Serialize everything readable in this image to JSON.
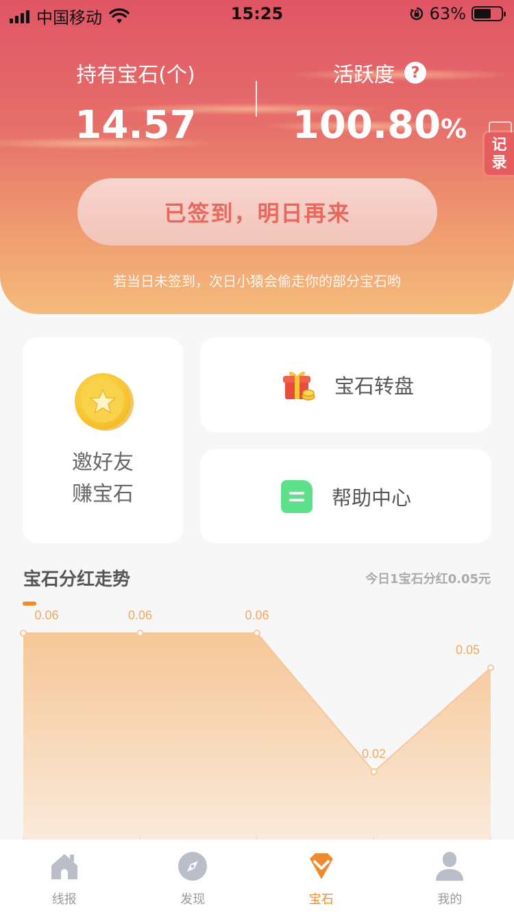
{
  "status_bar": {
    "carrier": "中国移动",
    "time": "15:25",
    "battery": "63%"
  },
  "stats": {
    "gems_label": "持有宝石(个)",
    "gems_value": "14.57",
    "activity_label": "活跃度",
    "activity_value": "100.80",
    "activity_unit": "%"
  },
  "record_tab": {
    "line1": "记",
    "line2": "录"
  },
  "checkin": {
    "button_label": "已签到，明日再来",
    "hint": "若当日未签到，次日小猿会偷走你的部分宝石哟"
  },
  "cards": {
    "invite_line1": "邀好友",
    "invite_line2": "赚宝石",
    "wheel_label": "宝石转盘",
    "help_label": "帮助中心"
  },
  "trend": {
    "title": "宝石分红走势",
    "note": "今日1宝石分红0.05元"
  },
  "chart_data": {
    "type": "area",
    "title": "宝石分红走势",
    "x": [
      "",
      "",
      "",
      "",
      ""
    ],
    "series": [
      {
        "values": [
          0.06,
          0.06,
          0.06,
          0.02,
          0.05
        ]
      }
    ],
    "data_labels": [
      "0.06",
      "0.06",
      "0.06",
      "0.02",
      "0.05"
    ],
    "ylim": [
      0.0,
      0.06
    ],
    "grid": false,
    "colors": {
      "line": "#f5c79c",
      "fill_top": "#f6c797",
      "fill_bottom": "#faeadb",
      "label": "#f0a860",
      "legend": "#ef8a2e"
    }
  },
  "tabbar": {
    "items": [
      {
        "label": "线报",
        "icon": "home-icon"
      },
      {
        "label": "发现",
        "icon": "compass-icon"
      },
      {
        "label": "宝石",
        "icon": "gem-icon"
      },
      {
        "label": "我的",
        "icon": "user-icon"
      }
    ],
    "active_index": 2
  },
  "colors": {
    "accent": "#ef8a2e",
    "hero_top": "#e05565",
    "hero_bottom": "#f5bb7b",
    "checkin_text": "#e8685e"
  }
}
